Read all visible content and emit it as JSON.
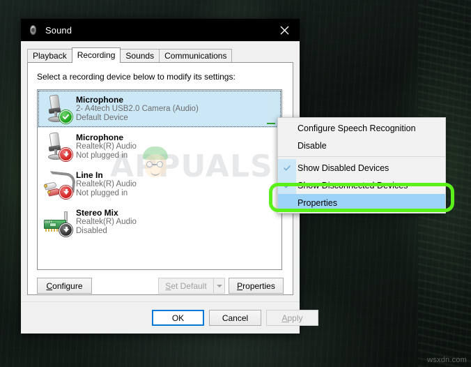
{
  "window": {
    "title": "Sound",
    "icon": "speaker-icon",
    "close_label": "✕"
  },
  "tabs": [
    {
      "label": "Playback",
      "selected": false
    },
    {
      "label": "Recording",
      "selected": true
    },
    {
      "label": "Sounds",
      "selected": false
    },
    {
      "label": "Communications",
      "selected": false
    }
  ],
  "page": {
    "prompt": "Select a recording device below to modify its settings:"
  },
  "devices": [
    {
      "name": "Microphone",
      "driver": "2- A4tech USB2.0 Camera (Audio)",
      "status": "Default Device",
      "icon": "microphone-icon",
      "badge": "check-badge",
      "selected": true,
      "meter_segments": 11,
      "meter_active": 1
    },
    {
      "name": "Microphone",
      "driver": "Realtek(R) Audio",
      "status": "Not plugged in",
      "icon": "microphone-icon",
      "badge": "red-down-arrow-badge",
      "selected": false
    },
    {
      "name": "Line In",
      "driver": "Realtek(R) Audio",
      "status": "Not plugged in",
      "icon": "rca-cable-icon",
      "badge": "red-down-arrow-badge",
      "selected": false
    },
    {
      "name": "Stereo Mix",
      "driver": "Realtek(R) Audio",
      "status": "Disabled",
      "icon": "pci-card-icon",
      "badge": "dark-down-arrow-badge",
      "selected": false
    }
  ],
  "mid_buttons": {
    "configure": {
      "label": "Configure",
      "accel": "C",
      "disabled": false
    },
    "set_default": {
      "label": "Set Default",
      "accel": "S",
      "disabled": true
    },
    "properties": {
      "label": "Properties",
      "accel": "P",
      "disabled": false
    }
  },
  "footer_buttons": {
    "ok": {
      "label": "OK",
      "focused": true
    },
    "cancel": {
      "label": "Cancel",
      "focused": false
    },
    "apply": {
      "label": "Apply",
      "accel": "A",
      "disabled": true
    }
  },
  "context_menu": {
    "items": [
      {
        "label": "Configure Speech Recognition",
        "checked": false,
        "highlighted": false,
        "separator_after": false
      },
      {
        "label": "Disable",
        "checked": false,
        "highlighted": false,
        "separator_after": true
      },
      {
        "label": "Show Disabled Devices",
        "checked": true,
        "highlighted": false,
        "separator_after": false
      },
      {
        "label": "Show Disconnected Devices",
        "checked": true,
        "highlighted": false,
        "separator_after": false
      },
      {
        "label": "Properties",
        "checked": false,
        "highlighted": true,
        "separator_after": false
      }
    ]
  },
  "annotation": {
    "highlight_color": "#5bf01a",
    "target": "Properties"
  },
  "watermarks": {
    "dialog": "APPUALS",
    "corner": "wsxdn.com"
  },
  "colors": {
    "accent": "#0078d7",
    "selection": "#cce8f7",
    "menu_highlight": "#9ed3f8",
    "meter_active": "#2ca02c"
  }
}
